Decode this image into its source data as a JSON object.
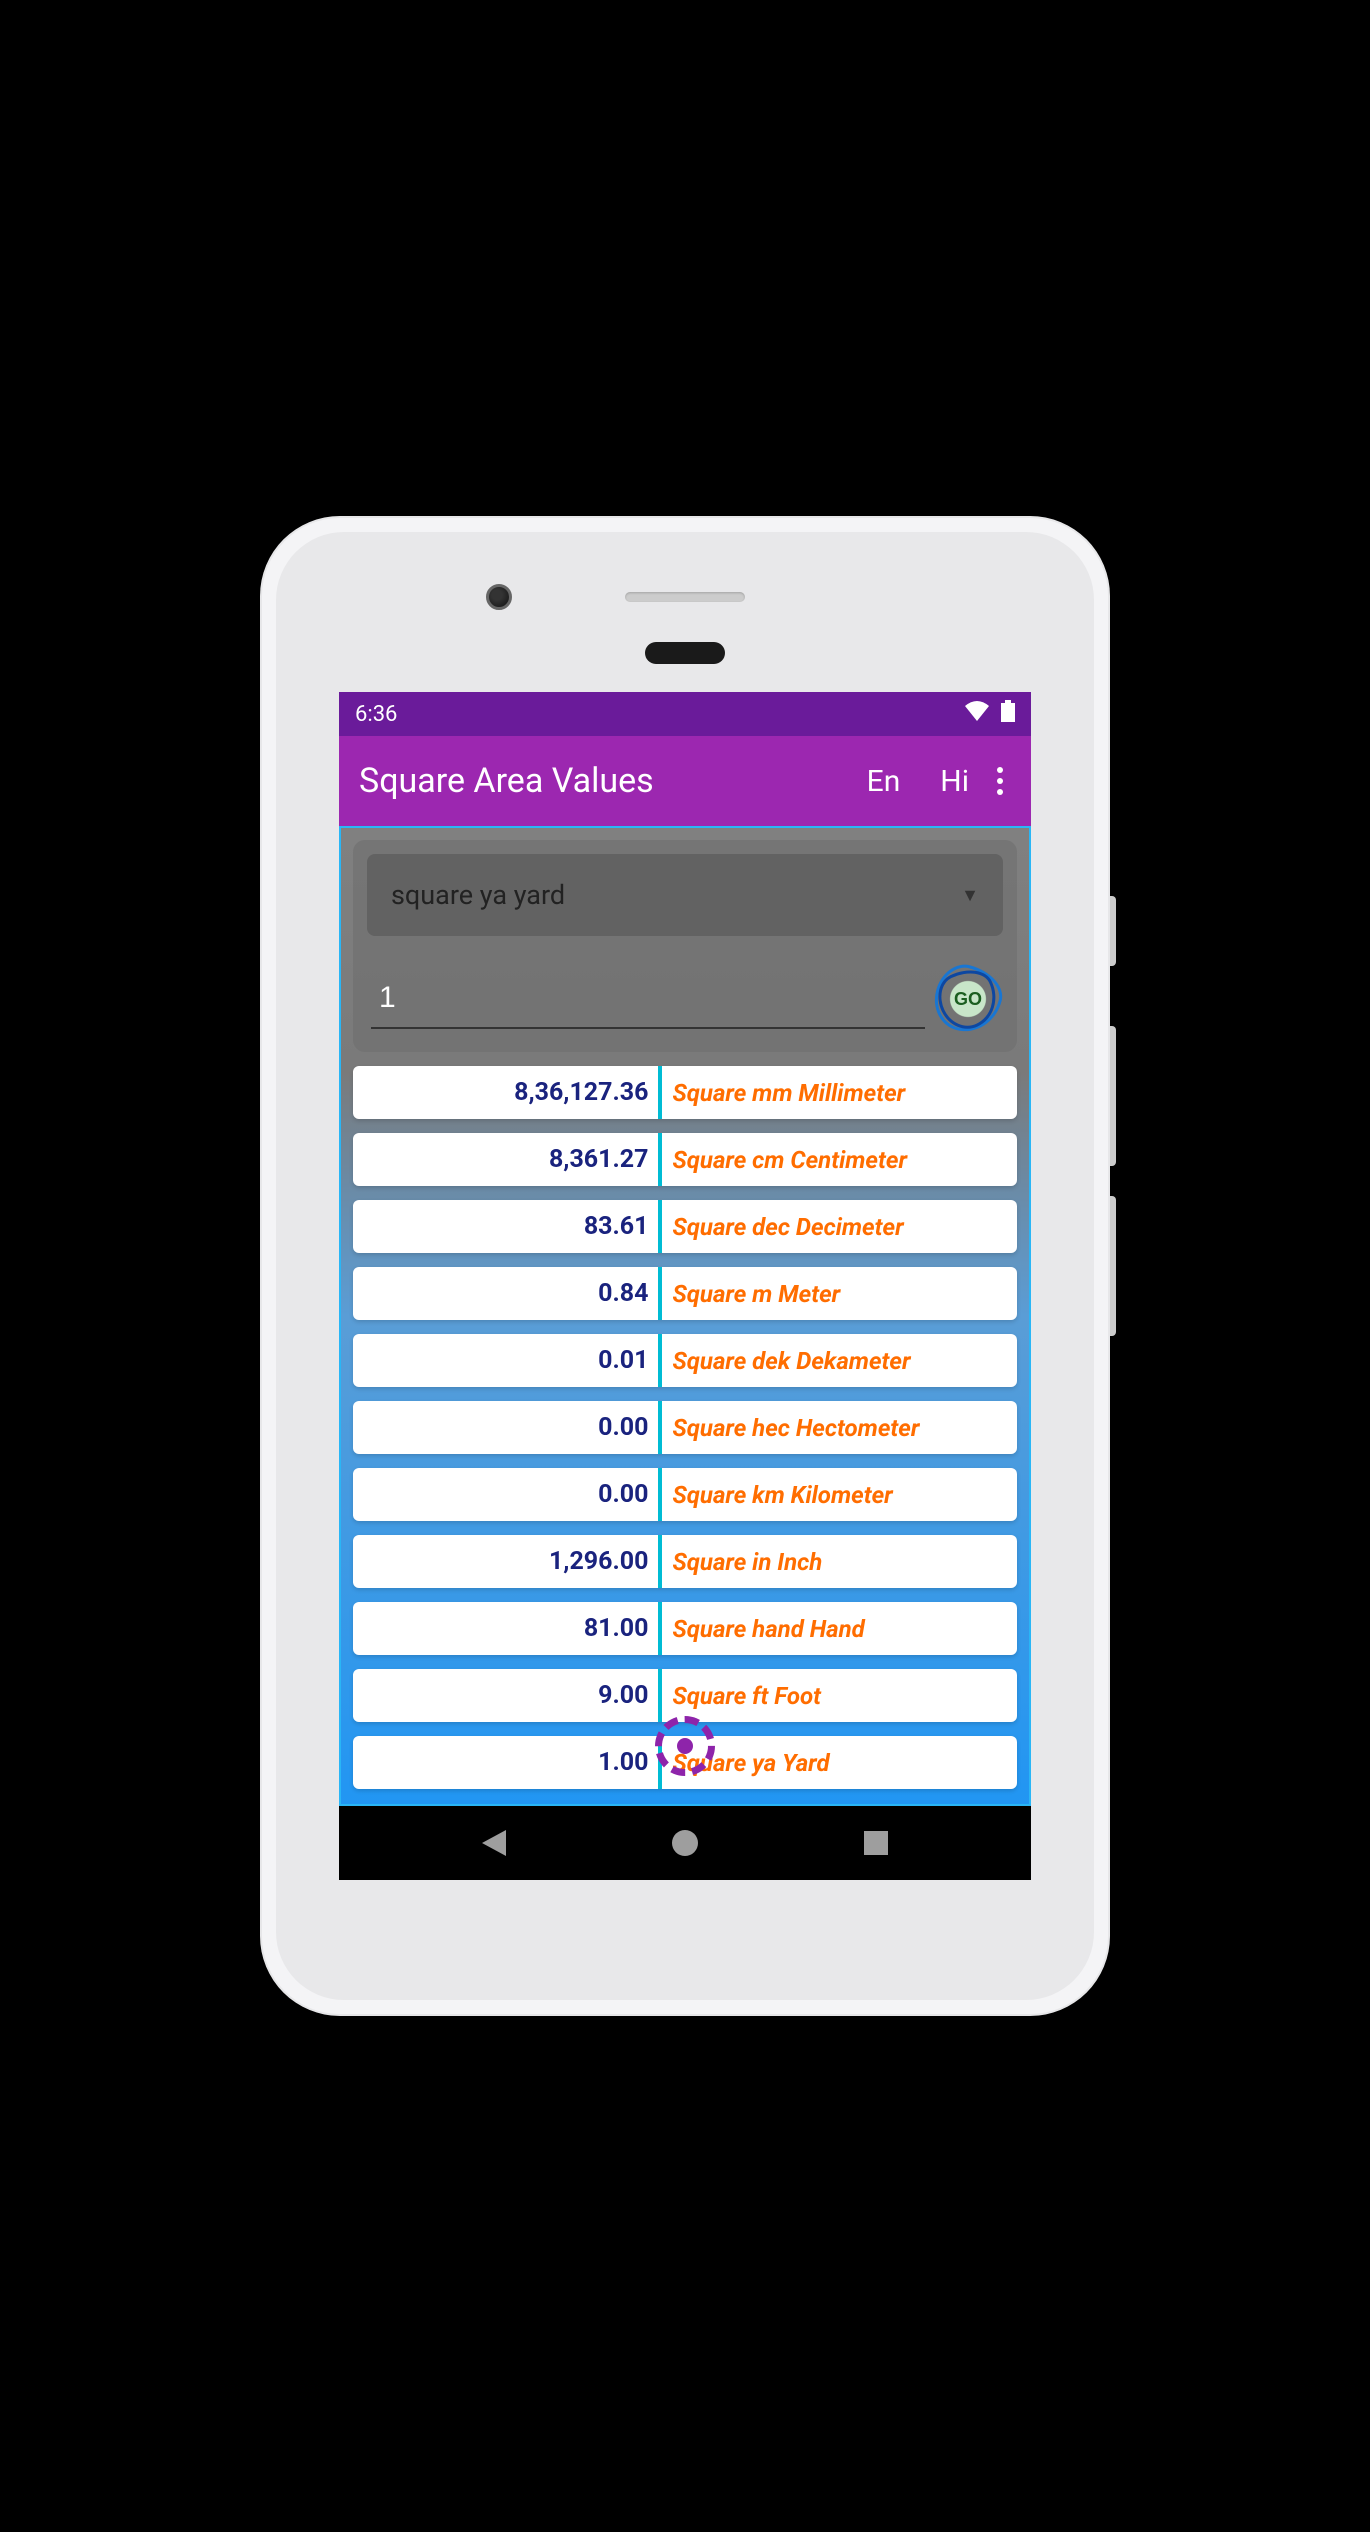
{
  "status": {
    "time": "6:36"
  },
  "appbar": {
    "title": "Square Area Values",
    "lang_en": "En",
    "lang_hi": "Hi"
  },
  "input": {
    "dropdown_selected": "square ya yard",
    "value": "1",
    "go_label": "GO"
  },
  "results": [
    {
      "value": "8,36,127.36",
      "label": "Square mm Millimeter"
    },
    {
      "value": "8,361.27",
      "label": "Square cm Centimeter"
    },
    {
      "value": "83.61",
      "label": "Square dec Decimeter"
    },
    {
      "value": "0.84",
      "label": "Square m Meter"
    },
    {
      "value": "0.01",
      "label": "Square dek Dekameter"
    },
    {
      "value": "0.00",
      "label": "Square hec Hectometer"
    },
    {
      "value": "0.00",
      "label": "Square km Kilometer"
    },
    {
      "value": "1,296.00",
      "label": "Square in Inch"
    },
    {
      "value": "81.00",
      "label": "Square hand Hand"
    },
    {
      "value": "9.00",
      "label": "Square ft Foot"
    },
    {
      "value": "1.00",
      "label": "Square ya Yard"
    }
  ]
}
